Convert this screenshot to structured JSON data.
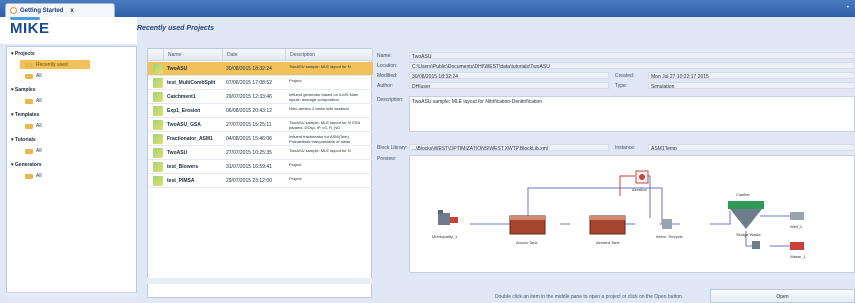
{
  "tab": {
    "label": "Getting Started",
    "close": "x",
    "pin": "•"
  },
  "logo": "MIKE",
  "header": "Recently used Projects",
  "tree": [
    {
      "label": "Projects",
      "children": [
        "Recently used",
        "All"
      ]
    },
    {
      "label": "Samples",
      "children": [
        "All"
      ]
    },
    {
      "label": "Templates",
      "children": [
        "All"
      ]
    },
    {
      "label": "Tutorials",
      "children": [
        "All"
      ]
    },
    {
      "label": "Generators",
      "children": [
        "All"
      ]
    }
  ],
  "table": {
    "headers": [
      "Name",
      "Date",
      "Description"
    ],
    "rows": [
      {
        "name": "TwoASU",
        "date": "30/08/2015 18:32:24",
        "desc": "TwoASU sample: MLE layout for N"
      },
      {
        "name": "test_MultiCombSplit",
        "date": "07/06/2015 17:08:52",
        "desc": "Project"
      },
      {
        "name": "Catchment1",
        "date": "29/07/2015 12:33:46",
        "desc": "Influent generator based on ILMS Main inputs: average composition"
      },
      {
        "name": "Exp1_Erosion",
        "date": "06/08/2015 20:43:12",
        "desc": "Nitro-denitro 2 tanks with aeration"
      },
      {
        "name": "TwoASU_GSA",
        "date": "27/07/2015 15:25:11",
        "desc": "TwoASU sample: MLE layout for N GSA params: DOsp, iP, vS, R_NO"
      },
      {
        "name": "Fractionator_ASM1",
        "date": "04/08/2015 15:46:06",
        "desc": "Influent fractionator for ASM(Tem) Probabilistic interpretation of meas"
      },
      {
        "name": "TwoASU",
        "date": "27/07/2015 10:25:35",
        "desc": "TwoASU sample: MLE layout for N"
      },
      {
        "name": "test_Blowers",
        "date": "31/07/2015 16:59:41",
        "desc": "Project"
      },
      {
        "name": "test_PIMSA",
        "date": "29/07/2015 23:12:00",
        "desc": "Project"
      }
    ]
  },
  "details": {
    "name_label": "Name:",
    "name": "TwoASU",
    "location_label": "Location:",
    "location": "C:\\Users\\Public\\Documents\\DHI\\WEST\\data\\tutorials\\TwoASU",
    "modified_label": "Modified:",
    "modified": "30/08/2015 18:32:24",
    "created_label": "Created:",
    "created": "Mon Jul 27 10:22:17 2015",
    "author_label": "Author:",
    "author": "DHIuser",
    "type_label": "Type:",
    "type": "Simulation",
    "description_label": "Description:",
    "description": "TwoASU sample: MLE layout for Nitrification-Denitrification",
    "block_label": "Block Library:",
    "block": "...\\Blocks\\WEST\\OPTIMIZATIONS\\WEST.XWTP.BlockLib.xml",
    "instance_label": "Instance:",
    "instance": "ASM1Temp",
    "preview_label": "Preview:"
  },
  "diagram": {
    "influent": "Municipality_1",
    "anoxic": "Anoxic Tank",
    "aerated": "Aerated Tank",
    "aeration": "Aeration",
    "recycle": "Intern. Recycle",
    "clarifier": "Clarifier",
    "effluent": "Well_1",
    "sludge": "Sludge Waste",
    "waste": "Waste_1"
  },
  "hint": "Double click an item in the middle pane to open a project or click on the Open button.",
  "open_button": "Open",
  "colors": {
    "accent": "#f2c15a",
    "title_bar": "#3a6db4"
  }
}
